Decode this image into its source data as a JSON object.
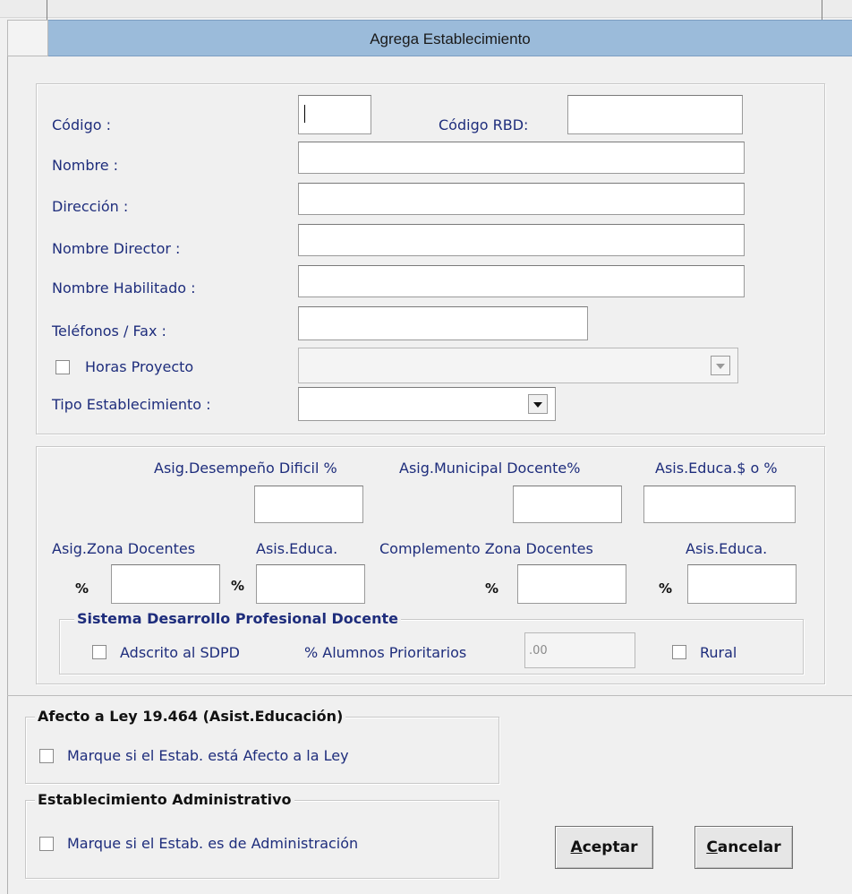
{
  "window": {
    "title": "Agrega Establecimiento"
  },
  "form": {
    "codigo_label": "Código :",
    "codigo_value": "",
    "codigo_rbd_label": "Código RBD:",
    "codigo_rbd_value": "",
    "nombre_label": "Nombre :",
    "direccion_label": "Dirección :",
    "nombre_director_label": "Nombre Director :",
    "nombre_habilitado_label": "Nombre Habilitado :",
    "telefonos_label": "Teléfonos / Fax :",
    "horas_proyecto_label": "Horas Proyecto",
    "tipo_establecimiento_label": "Tipo Establecimiento :"
  },
  "asignaciones": {
    "desempeno_label": "Asig.Desempeño Dificil %",
    "municipal_label": "Asig.Municipal Docente%",
    "asis_educa_pct_label": "Asis.Educa.$ o %",
    "zona_docentes_label": "Asig.Zona Docentes",
    "asis_educa_label_1": "Asis.Educa.",
    "complemento_label": "Complemento Zona Docentes",
    "asis_educa_label_2": "Asis.Educa.",
    "pct_1": "%",
    "pct_2": "%",
    "pct_3": "%",
    "pct_4": "%"
  },
  "sdpd": {
    "legend": "Sistema Desarrollo Profesional Docente",
    "adscrito_label": "Adscrito al SDPD",
    "alumnos_label": "% Alumnos Prioritarios",
    "alumnos_value": ".00",
    "rural_label": "Rural"
  },
  "ley": {
    "legend": "Afecto a Ley 19.464 (Asist.Educación)",
    "checkbox_label": "Marque si el Estab. está Afecto a la Ley"
  },
  "administrativo": {
    "legend": "Establecimiento Administrativo",
    "checkbox_label": "Marque si el Estab. es de Administración"
  },
  "buttons": {
    "aceptar_accel": "A",
    "aceptar_rest": "ceptar",
    "cancelar_accel": "C",
    "cancelar_rest": "ancelar"
  }
}
